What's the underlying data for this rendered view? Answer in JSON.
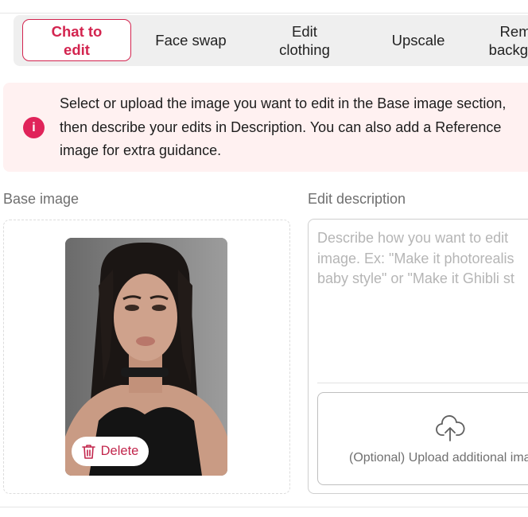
{
  "tabs": [
    {
      "label": "Chat to\nedit",
      "active": true
    },
    {
      "label": "Face swap",
      "active": false
    },
    {
      "label": "Edit\nclothing",
      "active": false
    },
    {
      "label": "Upscale",
      "active": false
    },
    {
      "label": "Remove\nbackground",
      "active": false
    }
  ],
  "info": {
    "text": "Select or upload the image you want to edit in the Base image section, then describe your edits in Description. You can also add a Reference image for extra guidance.",
    "icon": "info-icon",
    "icon_glyph": "i"
  },
  "base_image": {
    "label": "Base image",
    "delete_label": "Delete",
    "image_alt": "portrait photo of a woman"
  },
  "edit_description": {
    "label": "Edit description",
    "placeholder": "Describe how you want to edit the image. Ex: \"Make it photorealistic\", \"Baby style\" or \"Make it Ghibli style\"",
    "placeholder_lines": [
      "Describe how you want to edit",
      "image. Ex: \"Make it photorealis",
      "baby style\" or \"Make it Ghibli st"
    ],
    "upload_label": "(Optional) Upload additional image"
  },
  "colors": {
    "accent": "#d3244f",
    "info_bg": "#fff1f1",
    "tab_bar_bg": "#efefef"
  }
}
